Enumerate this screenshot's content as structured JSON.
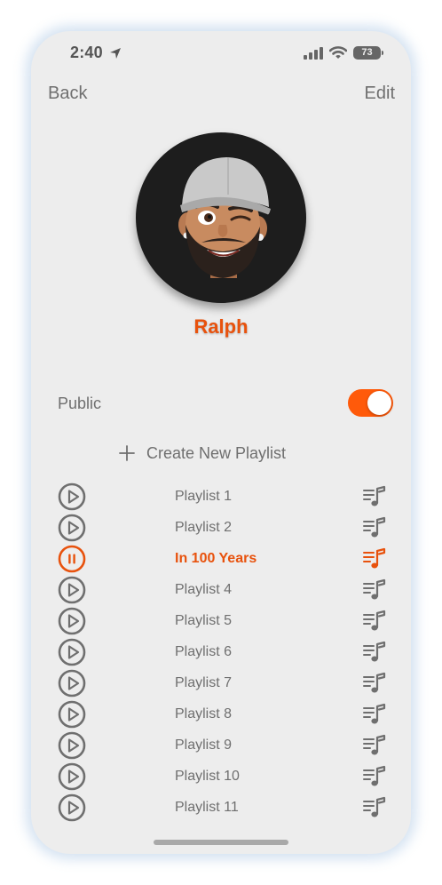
{
  "status_bar": {
    "time": "2:40",
    "battery": "73"
  },
  "nav": {
    "back": "Back",
    "edit": "Edit"
  },
  "profile": {
    "name": "Ralph"
  },
  "settings": {
    "public_label": "Public",
    "public_enabled": true
  },
  "actions": {
    "create_playlist": "Create New Playlist"
  },
  "playlists": [
    {
      "title": "Playlist 1",
      "state": "play"
    },
    {
      "title": "Playlist 2",
      "state": "play"
    },
    {
      "title": "In 100 Years",
      "state": "pause"
    },
    {
      "title": "Playlist 4",
      "state": "play"
    },
    {
      "title": "Playlist 5",
      "state": "play"
    },
    {
      "title": "Playlist 6",
      "state": "play"
    },
    {
      "title": "Playlist 7",
      "state": "play"
    },
    {
      "title": "Playlist 8",
      "state": "play"
    },
    {
      "title": "Playlist 9",
      "state": "play"
    },
    {
      "title": "Playlist 10",
      "state": "play"
    },
    {
      "title": "Playlist 11",
      "state": "play"
    }
  ],
  "colors": {
    "accent": "#e8520d",
    "toggle_on": "#ff5a0a",
    "text": "#6f6f6f",
    "background": "#ededed"
  },
  "icons": {
    "play": "play-circle-icon",
    "pause": "pause-circle-icon",
    "queue": "playlist-queue-icon",
    "add": "plus-icon"
  }
}
